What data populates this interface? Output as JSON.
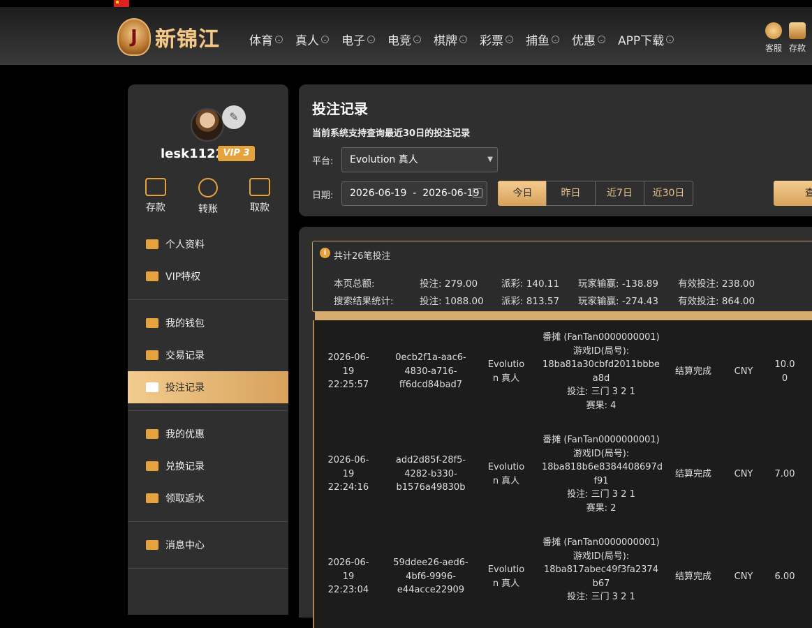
{
  "header": {
    "logo_letter": "J",
    "logo_text": "新锦江",
    "nav": [
      "体育",
      "真人",
      "电子",
      "电竞",
      "棋牌",
      "彩票",
      "捕鱼",
      "优惠",
      "APP下载"
    ],
    "right": [
      {
        "label": "客服",
        "icon": "support-icon"
      },
      {
        "label": "存款",
        "icon": "wallet-icon"
      }
    ]
  },
  "sidebar": {
    "username": "lesk1122",
    "vip": "VIP 3",
    "quick": [
      {
        "label": "存款",
        "icon": "wallet-icon"
      },
      {
        "label": "转账",
        "icon": "transfer-icon"
      },
      {
        "label": "取款",
        "icon": "card-icon"
      }
    ],
    "items": [
      {
        "label": "个人资料"
      },
      {
        "label": "VIP特权"
      },
      {
        "label": "我的钱包"
      },
      {
        "label": "交易记录"
      },
      {
        "label": "投注记录"
      },
      {
        "label": "我的优惠"
      },
      {
        "label": "兑换记录"
      },
      {
        "label": "领取返水"
      },
      {
        "label": "消息中心"
      }
    ]
  },
  "main": {
    "title": "投注记录",
    "subtitle": "当前系统支持查询最近30日的投注记录",
    "platform_label": "平台:",
    "platform_value": "Evolution 真人",
    "date_label": "日期:",
    "date_range": "2026-06-19  -  2026-06-19",
    "quick_dates": [
      "今日",
      "昨日",
      "近7日",
      "近30日"
    ],
    "search_label": "查"
  },
  "summary": {
    "count_text": "共计26笔投注",
    "page_label": "本页总额:",
    "page": {
      "bet": "投注: 279.00",
      "payout": "派彩: 140.11",
      "winloss": "玩家输赢: -138.89",
      "valid": "有效投注: 238.00"
    },
    "search_label": "搜索结果统计:",
    "search": {
      "bet": "投注: 1088.00",
      "payout": "派彩: 813.57",
      "winloss": "玩家输赢: -274.43",
      "valid": "有效投注: 864.00"
    }
  },
  "rows": [
    {
      "date": "2026-06-",
      "date2": "19",
      "time": "22:25:57",
      "id1": "0ecb2f1a-aac6-",
      "id2": "4830-a716-",
      "id3": "ff6dcd84bad7",
      "plat1": "Evolutio",
      "plat2": "n 真人",
      "d1": "番摊 (FanTan0000000001)",
      "d2": "游戏ID(局号):",
      "d3": "18ba81a30cbfd2011bbbe",
      "d4": "a8d",
      "d5": "投注: 三门 3 2 1",
      "d6": "赛果: 4",
      "status": "结算完成",
      "currency": "CNY",
      "amt1": "10.0",
      "amt2": "0"
    },
    {
      "date": "2026-06-",
      "date2": "19",
      "time": "22:24:16",
      "id1": "add2d85f-28f5-",
      "id2": "4282-b330-",
      "id3": "b1576a49830b",
      "plat1": "Evolutio",
      "plat2": "n 真人",
      "d1": "番摊 (FanTan0000000001)",
      "d2": "游戏ID(局号):",
      "d3": "18ba818b6e8384408697d",
      "d4": "f91",
      "d5": "投注: 三门 3 2 1",
      "d6": "赛果: 2",
      "status": "结算完成",
      "currency": "CNY",
      "amt1": "7.00",
      "amt2": ""
    },
    {
      "date": "2026-06-",
      "date2": "19",
      "time": "22:23:04",
      "id1": "59ddee26-aed6-",
      "id2": "4bf6-9996-",
      "id3": "e44acce22909",
      "plat1": "Evolutio",
      "plat2": "n 真人",
      "d1": "番摊 (FanTan0000000001)",
      "d2": "游戏ID(局号):",
      "d3": "18ba817abec49f3fa2374",
      "d4": "b67",
      "d5": "投注: 三门 3 2 1",
      "d6": "",
      "status": "结算完成",
      "currency": "CNY",
      "amt1": "6.00",
      "amt2": ""
    }
  ],
  "colors": {
    "accent": "#e6a23c",
    "gold_light": "#f3cc8f",
    "panel": "#2f2f2f"
  }
}
